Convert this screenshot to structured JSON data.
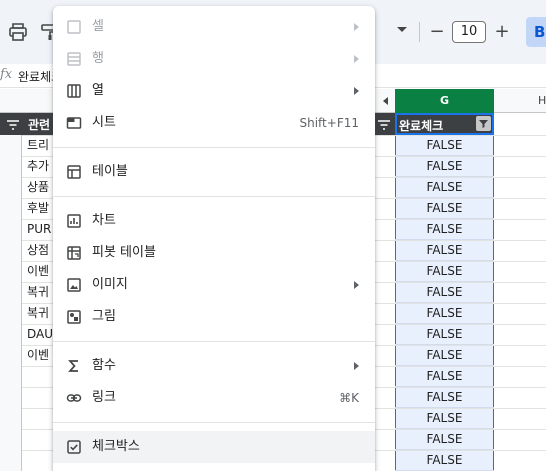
{
  "toolbar": {
    "font_size": "10",
    "minus_label": "−",
    "plus_label": "+",
    "bold_label": "B"
  },
  "formula_bar": {
    "fx": "fx",
    "text": "완료체크"
  },
  "columns": {
    "g": "G",
    "h": "H"
  },
  "sheet": {
    "header_left": "관련",
    "header_g": "완료체크",
    "left_cells": [
      "트리",
      "추가",
      "상품",
      "후발",
      "PUR",
      "상점",
      "이벤",
      "복귀",
      "복귀",
      "DAU",
      "이벤"
    ],
    "g_values": [
      "FALSE",
      "FALSE",
      "FALSE",
      "FALSE",
      "FALSE",
      "FALSE",
      "FALSE",
      "FALSE",
      "FALSE",
      "FALSE",
      "FALSE",
      "FALSE",
      "FALSE",
      "FALSE",
      "FALSE",
      "FALSE"
    ]
  },
  "menu": {
    "items": [
      {
        "label": "셀",
        "icon": "checkbox-outline-icon",
        "disabled": true,
        "submenu": true
      },
      {
        "label": "행",
        "icon": "rows-icon",
        "disabled": true,
        "submenu": true
      },
      {
        "label": "열",
        "icon": "columns-icon",
        "submenu": true
      },
      {
        "label": "시트",
        "icon": "sheet-tab-icon",
        "shortcut": "Shift+F11"
      },
      {
        "label": "테이블",
        "icon": "table-icon"
      },
      {
        "label": "차트",
        "icon": "chart-icon"
      },
      {
        "label": "피봇 테이블",
        "icon": "pivot-table-icon"
      },
      {
        "label": "이미지",
        "icon": "image-icon",
        "submenu": true
      },
      {
        "label": "그림",
        "icon": "drawing-icon"
      },
      {
        "label": "함수",
        "icon": "sigma-icon",
        "submenu": true
      },
      {
        "label": "링크",
        "icon": "link-icon",
        "shortcut": "⌘K"
      },
      {
        "label": "체크박스",
        "icon": "checkbox-icon"
      }
    ]
  }
}
